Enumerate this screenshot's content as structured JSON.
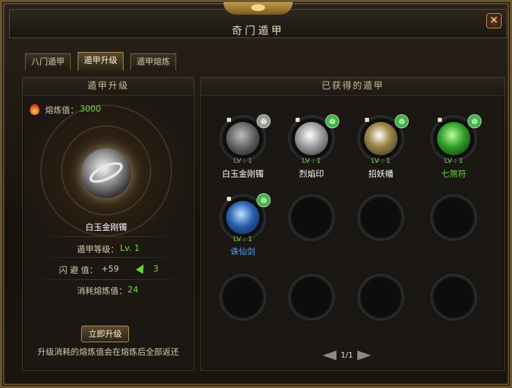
{
  "window": {
    "title": "奇门遁甲",
    "close_icon": "close-icon"
  },
  "tabs": [
    {
      "label": "八门遁甲",
      "active": false
    },
    {
      "label": "遁甲升级",
      "active": true
    },
    {
      "label": "遁甲熔炼",
      "active": false
    }
  ],
  "left": {
    "header": "遁甲升级",
    "smelt_label": "熔炼值：",
    "smelt_value": "3000",
    "item_name": "白玉金刚镯",
    "level_label": "遁甲等级：",
    "level_value": "Lv. 1",
    "dodge_label": "闪 避 值：",
    "dodge_value": "+59",
    "dodge_increase": "3",
    "cost_label": "消耗熔炼值：",
    "cost_value": "24",
    "upgrade_button": "立即升级",
    "note": "升级消耗的熔炼值会在熔炼后全部返还"
  },
  "right": {
    "header": "已获得的遁甲",
    "items": [
      {
        "name": "白玉金刚镯",
        "level": "LV : 1",
        "color": "#ffffff",
        "rarity": "white"
      },
      {
        "name": "烈焰印",
        "level": "LV : 1",
        "color": "#ffffff",
        "rarity": "white"
      },
      {
        "name": "招妖幡",
        "level": "LV : 1",
        "color": "#ffffff",
        "rarity": "white"
      },
      {
        "name": "七煞符",
        "level": "LV : 1",
        "color": "#5fd64a",
        "rarity": "green"
      },
      {
        "name": "诛仙剑",
        "level": "LV : 1",
        "color": "#4aa8ff",
        "rarity": "blue"
      }
    ],
    "page": "1/1"
  }
}
